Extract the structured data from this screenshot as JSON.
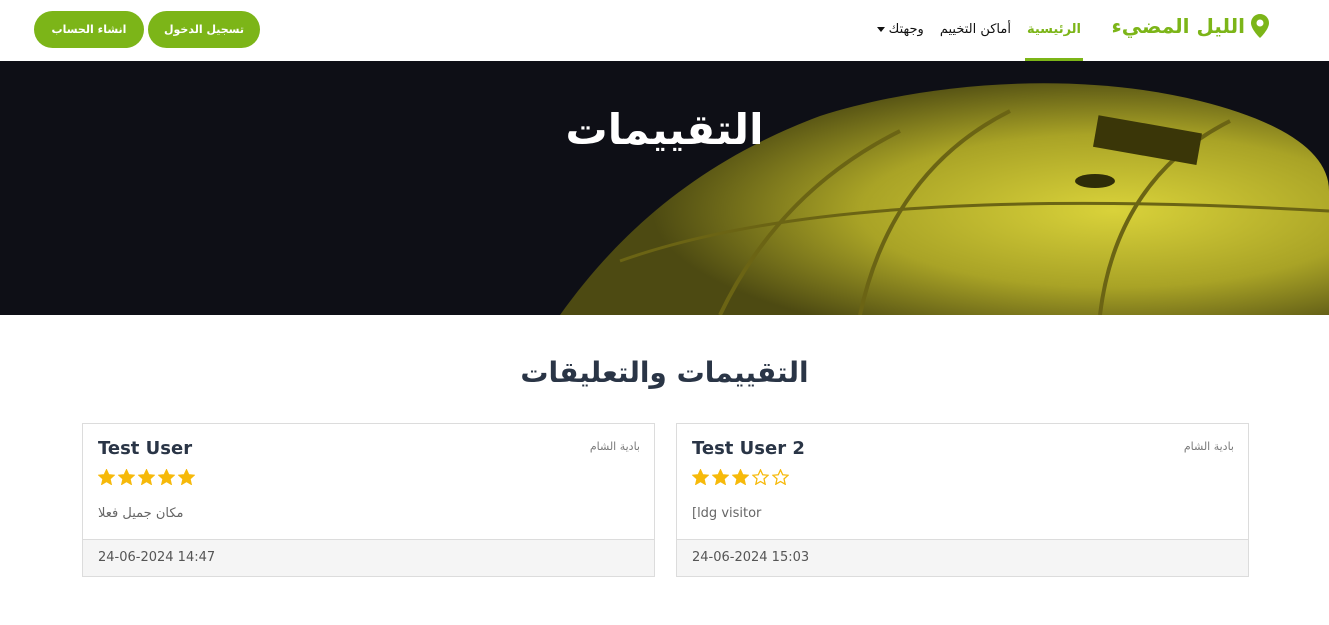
{
  "nav": {
    "brand": "الليل المضيء",
    "items": [
      {
        "label": "الرئيسية",
        "active": true
      },
      {
        "label": "أماكن التخييم",
        "active": false
      },
      {
        "label": "وجهتك",
        "active": false,
        "dropdown": true
      }
    ],
    "login_label": "تسجيل الدخول",
    "signup_label": "انشاء الحساب",
    "brand_icon": "map-pin-icon",
    "accent_color": "#7cb518"
  },
  "hero": {
    "title": "التقييمات"
  },
  "reviews_section": {
    "title": "التقييمات والتعليقات",
    "reviews": [
      {
        "user": "Test User",
        "place": "بادية الشام",
        "rating": 5,
        "max_rating": 5,
        "comment": "مكان جميل فعلا",
        "date": "24-06-2024 14:47"
      },
      {
        "user": "Test User 2",
        "place": "بادية الشام",
        "rating": 3,
        "max_rating": 5,
        "comment": "[ldg visitor",
        "date": "24-06-2024 15:03"
      }
    ],
    "star_color": "#f6b90a"
  }
}
